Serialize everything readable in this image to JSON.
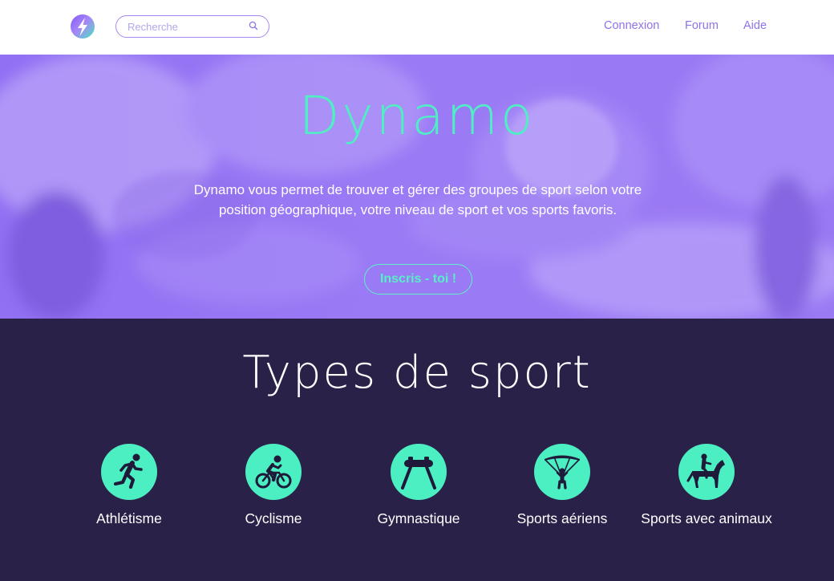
{
  "navbar": {
    "logo_icon": "lightning-bolt-icon",
    "search": {
      "placeholder": "Recherche",
      "value": "",
      "icon": "search-icon"
    },
    "links": [
      "Connexion",
      "Forum",
      "Aide"
    ]
  },
  "hero": {
    "title": "Dynamo",
    "description": "Dynamo vous permet de trouver et gérer des groupes de sport selon votre position géographique, votre niveau de sport et vos sports favoris.",
    "cta_label": "Inscris - toi !"
  },
  "sports_section": {
    "title": "Types de sport",
    "items": [
      {
        "label": "Athlétisme",
        "icon": "runner-icon"
      },
      {
        "label": "Cyclisme",
        "icon": "cyclist-icon"
      },
      {
        "label": "Gymnastique",
        "icon": "pommel-horse-icon"
      },
      {
        "label": "Sports aériens",
        "icon": "paraglider-icon"
      },
      {
        "label": "Sports avec animaux",
        "icon": "horse-rider-icon"
      }
    ]
  },
  "colors": {
    "accent_purple": "#9b7bf5",
    "accent_mint": "#4cefc2",
    "dark_background": "#2a2149",
    "nav_link": "#8e73e8"
  }
}
